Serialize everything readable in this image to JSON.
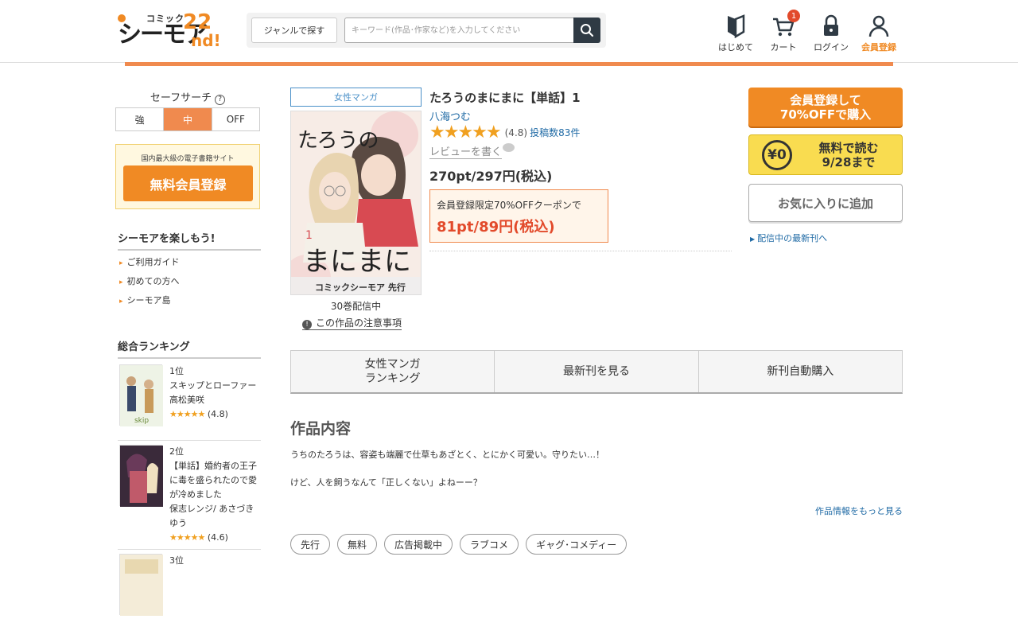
{
  "logo": {
    "small": "コミック",
    "main": "シーモア",
    "num": "22",
    "suffix": "nd!"
  },
  "search": {
    "genre_button": "ジャンルで探す",
    "placeholder": "キーワード(作品･作家など)を入力してください"
  },
  "nav": {
    "first": "はじめて",
    "cart": "カート",
    "cart_count": "1",
    "login": "ログイン",
    "register": "会員登録"
  },
  "sidebar": {
    "safe_search_label": "セーフサーチ",
    "safe_options": [
      "強",
      "中",
      "OFF"
    ],
    "promo_small": "国内最大級の電子書籍サイト",
    "promo_button": "無料会員登録",
    "enjoy_title": "シーモアを楽しもう!",
    "guides": [
      "ご利用ガイド",
      "初めての方へ",
      "シーモア島"
    ],
    "ranking_title": "総合ランキング",
    "ranking": [
      {
        "rank": "1位",
        "title": "スキップとローファー",
        "author": "高松美咲",
        "stars": "★★★★★",
        "score": "(4.8)"
      },
      {
        "rank": "2位",
        "title": "【単話】婚約者の王子に毒を盛られたので愛が冷めました",
        "author": "保志レンジ/ あさづきゆう",
        "stars": "★★★★★",
        "score": "(4.6)"
      },
      {
        "rank": "3位",
        "title": "",
        "author": "",
        "stars": "",
        "score": ""
      }
    ]
  },
  "book": {
    "genre": "女性マンガ",
    "title": "たろうのまにまに【単話】1",
    "author": "八海つむ",
    "stars": "★★★★★",
    "rating": "(4.8)",
    "review_count": "投稿数83件",
    "write_review": "レビューを書く",
    "price": "270pt/297円(税込)",
    "coupon_label": "会員登録限定70%OFFクーポンで",
    "coupon_price": "81pt/89円(税込)",
    "volumes": "30巻配信中",
    "notice": "この作品の注意事項",
    "cover_badge": "コミックシーモア 先行"
  },
  "actions": {
    "buy_line1": "会員登録して",
    "buy_line2": "70%OFFで購入",
    "free_yen": "¥0",
    "free_line1": "無料で読む",
    "free_line2": "9/28まで",
    "favorite": "お気に入りに追加",
    "newest": "配信中の最新刊へ"
  },
  "tabs": [
    "女性マンガ\nランキング",
    "最新刊を見る",
    "新刊自動購入"
  ],
  "content": {
    "heading": "作品内容",
    "line1": "うちのたろうは、容姿も端麗で仕草もあざとく、とにかく可愛い。守りたい…！",
    "line2": "けど、人を飼うなんて「正しくない」よねーー？",
    "more": "作品情報をもっと見る"
  },
  "tags": [
    "先行",
    "無料",
    "広告掲載中",
    "ラブコメ",
    "ギャグ･コメディー"
  ],
  "colors": {
    "accent": "#f08a24",
    "link": "#1f6aa5",
    "coupon_red": "#e24a2b"
  }
}
